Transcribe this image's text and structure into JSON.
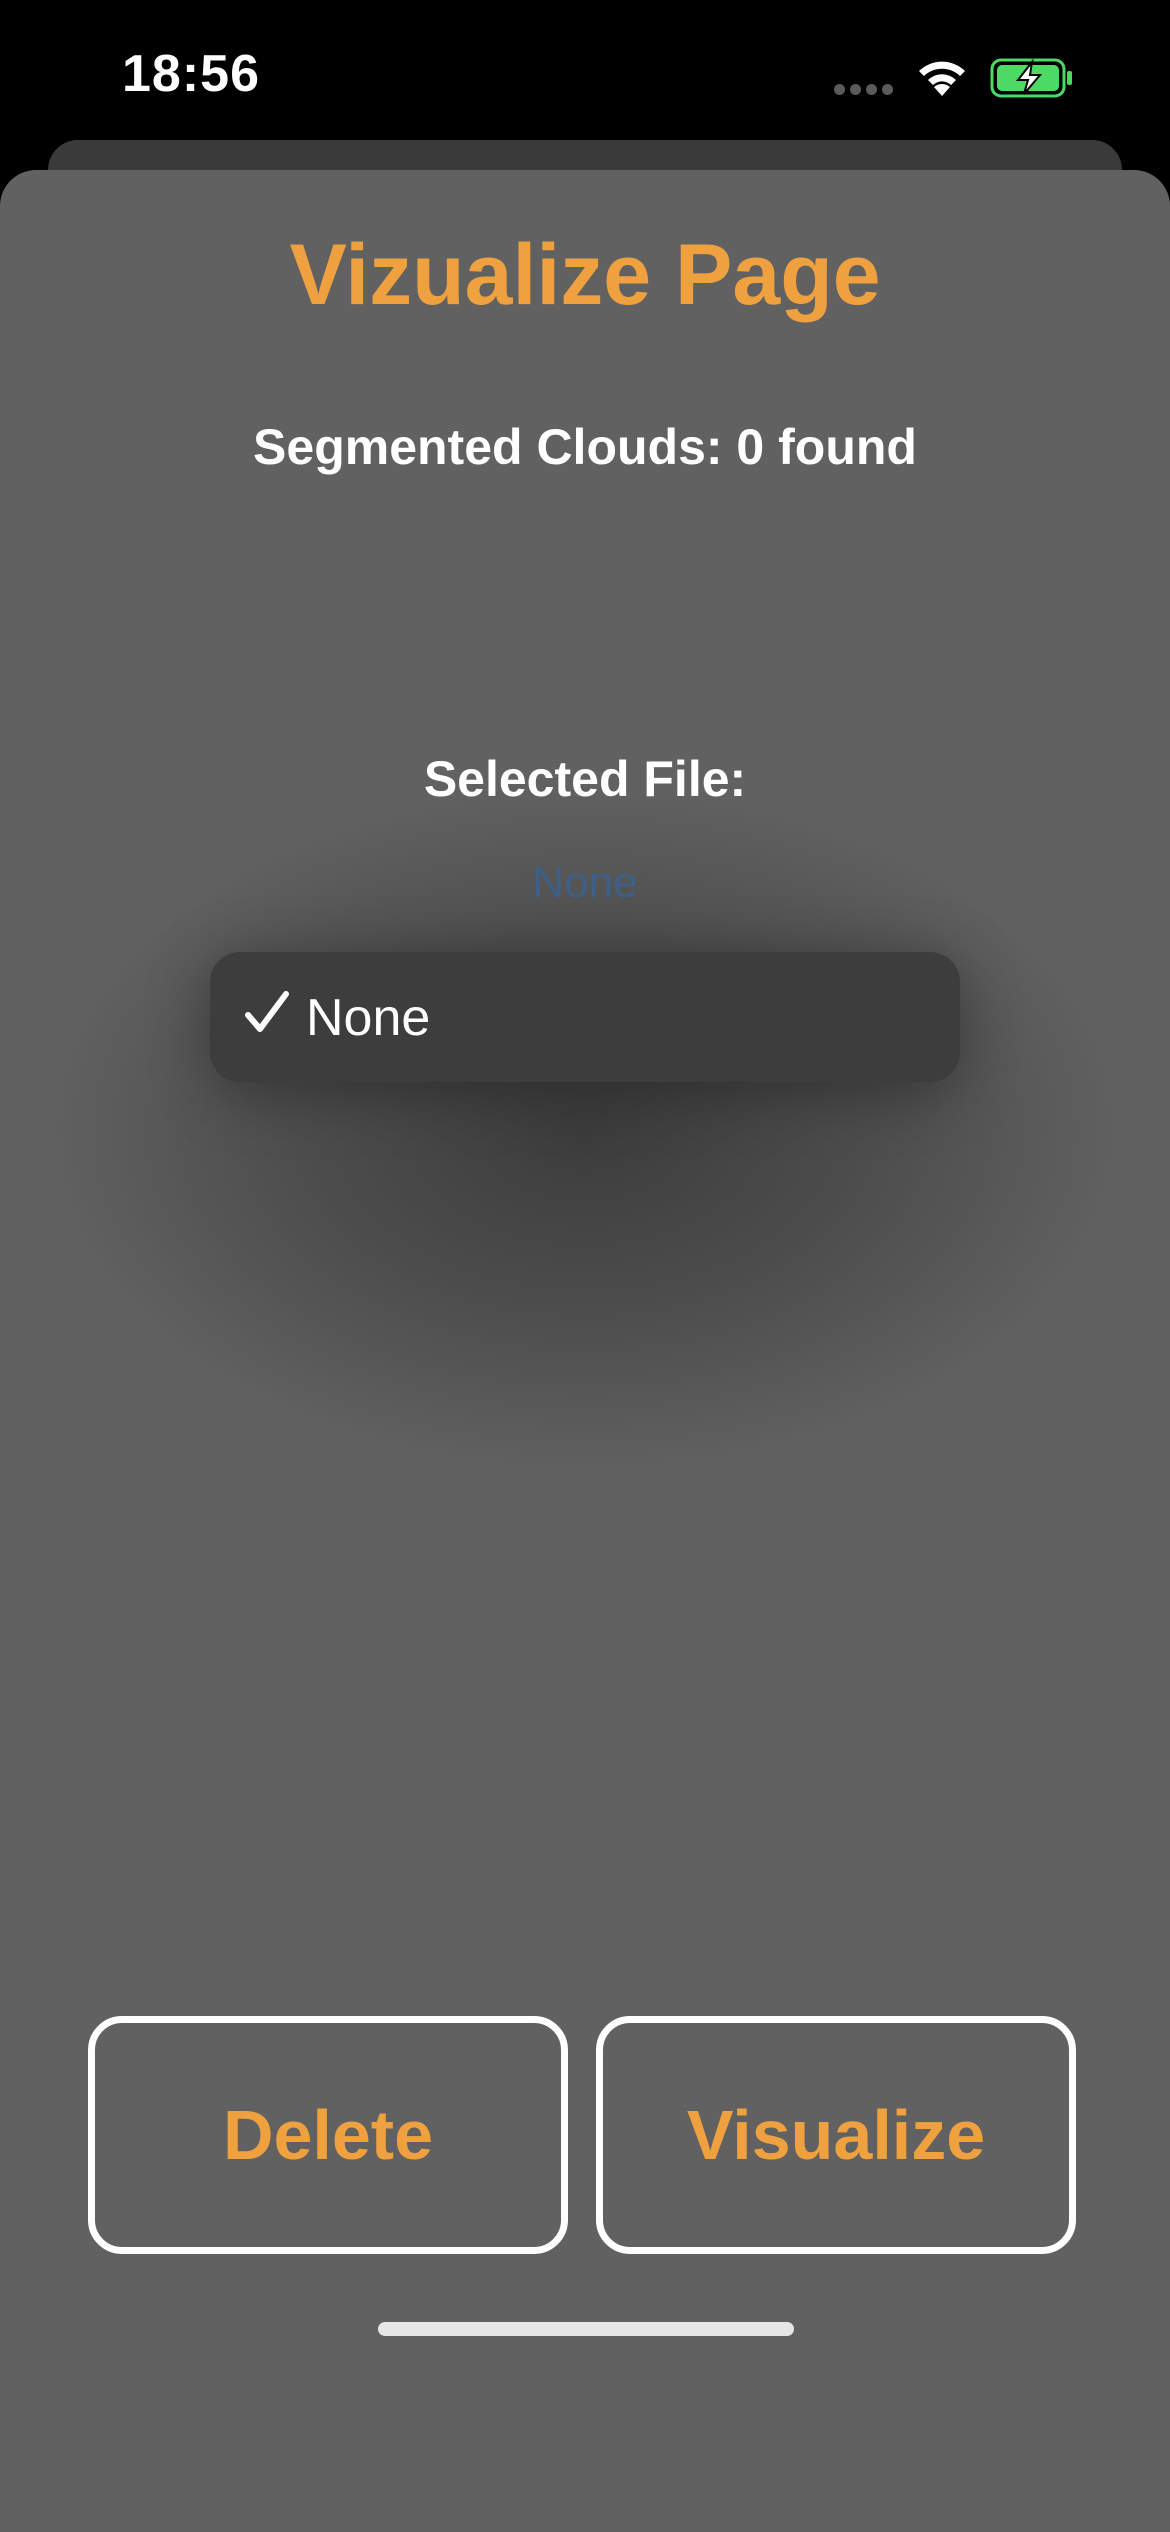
{
  "status_bar": {
    "time": "18:56",
    "icons": [
      "signal-dots-icon",
      "wifi-icon",
      "battery-charging-icon"
    ],
    "battery_color": "#4cd964"
  },
  "page": {
    "title": "Vizualize Page",
    "clouds_count_text": "Segmented Clouds: 0 found",
    "selected_file_label": "Selected File:",
    "selected_file_value": "None"
  },
  "menu": {
    "items": [
      {
        "label": "None",
        "checked": true
      }
    ]
  },
  "buttons": {
    "delete_label": "Delete",
    "visualize_label": "Visualize"
  },
  "colors": {
    "accent": "#f0a13f",
    "sheet_background": "#616161",
    "link_blue": "#3e5f86"
  }
}
